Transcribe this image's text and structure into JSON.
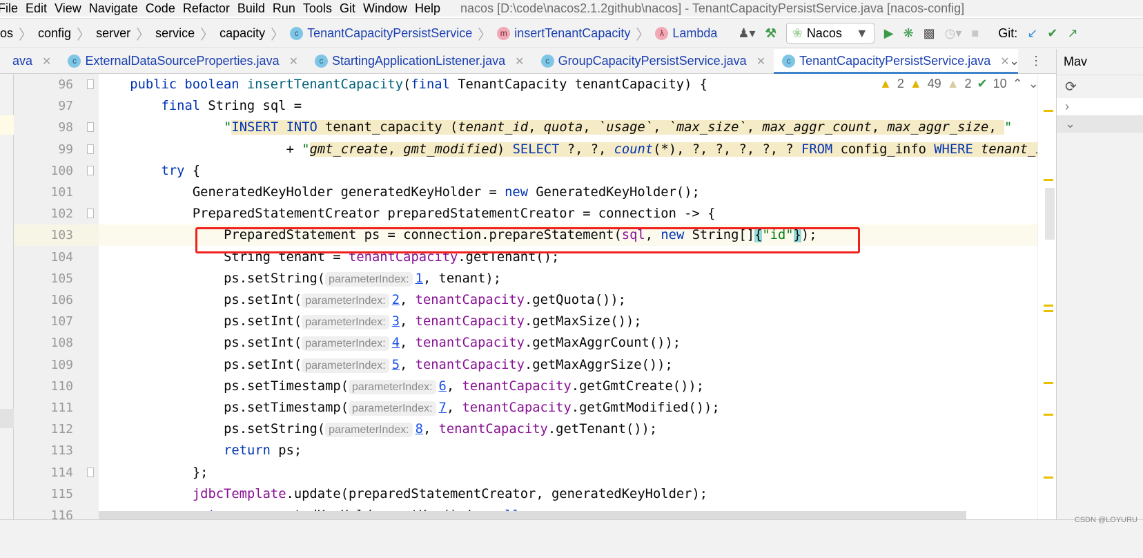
{
  "window_title": "nacos [D:\\code\\nacos2.1.2github\\nacos] - TenantCapacityPersistService.java [nacos-config]",
  "menu": [
    "File",
    "Edit",
    "View",
    "Navigate",
    "Code",
    "Refactor",
    "Build",
    "Run",
    "Tools",
    "Git",
    "Window",
    "Help"
  ],
  "breadcrumb": [
    "os",
    "config",
    "server",
    "service",
    "capacity",
    "TenantCapacityPersistService",
    "insertTenantCapacity",
    "Lambda"
  ],
  "toolbar": {
    "run_config": "Nacos",
    "git_label": "Git:"
  },
  "tabs": [
    {
      "label": "ava",
      "active": false
    },
    {
      "label": "ExternalDataSourceProperties.java",
      "active": false
    },
    {
      "label": "StartingApplicationListener.java",
      "active": false
    },
    {
      "label": "GroupCapacityPersistService.java",
      "active": false
    },
    {
      "label": "TenantCapacityPersistService.java",
      "active": true
    }
  ],
  "right_panel": {
    "label": "Mav"
  },
  "inspections": {
    "errors": "2",
    "warnings": "49",
    "weak_warnings": "2",
    "typos": "10"
  },
  "colors": {
    "keyword": "#0033b3",
    "string": "#067d17",
    "field": "#871094",
    "accent": "#4083c9",
    "annotation_box": "#f0201c"
  },
  "code": [
    {
      "n": "96",
      "indent": 4,
      "t": [
        [
          "kw",
          "public boolean "
        ],
        [
          "fn",
          "insertTenantCapacity"
        ],
        [
          "",
          "("
        ],
        [
          "kw",
          "final "
        ],
        [
          "",
          "TenantCapacity tenantCapacity) {"
        ]
      ]
    },
    {
      "n": "97",
      "indent": 8,
      "t": [
        [
          "kw",
          "final "
        ],
        [
          "",
          "String sql ="
        ]
      ]
    },
    {
      "n": "98",
      "indent": 16,
      "t": [
        [
          "str",
          "\""
        ],
        [
          "sql kw",
          "INSERT INTO "
        ],
        [
          "sql",
          "tenant_capacity ("
        ],
        [
          "sql it",
          "tenant_id"
        ],
        [
          "sql",
          ", "
        ],
        [
          "sql it",
          "quota"
        ],
        [
          "sql",
          ", "
        ],
        [
          "sql it",
          "`usage`"
        ],
        [
          "sql",
          ", "
        ],
        [
          "sql it",
          "`max_size`"
        ],
        [
          "sql",
          ", "
        ],
        [
          "sql it",
          "max_aggr_count"
        ],
        [
          "sql",
          ", "
        ],
        [
          "sql it",
          "max_aggr_size"
        ],
        [
          "sql",
          ", "
        ],
        [
          "str",
          "\""
        ]
      ]
    },
    {
      "n": "99",
      "indent": 24,
      "t": [
        [
          "",
          "+ "
        ],
        [
          "str",
          "\""
        ],
        [
          "sql it",
          "gmt_create"
        ],
        [
          "sql",
          ", "
        ],
        [
          "sql it",
          "gmt_modified"
        ],
        [
          "sql",
          ") "
        ],
        [
          "sql kw",
          "SELECT "
        ],
        [
          "sql",
          "?, ?, "
        ],
        [
          "sql kw it",
          "count"
        ],
        [
          "sql",
          "(*), ?, ?, ?, ?, ? "
        ],
        [
          "sql kw",
          "FROM "
        ],
        [
          "sql",
          "config_info "
        ],
        [
          "sql kw",
          "WHERE "
        ],
        [
          "sql it",
          "tenant_id = ?;                    "
        ]
      ]
    },
    {
      "n": "100",
      "indent": 8,
      "t": [
        [
          "kw",
          "try "
        ],
        [
          "",
          "{"
        ]
      ]
    },
    {
      "n": "101",
      "indent": 12,
      "t": [
        [
          "",
          "GeneratedKeyHolder generatedKeyHolder = "
        ],
        [
          "kw",
          "new "
        ],
        [
          "",
          "GeneratedKeyHolder();"
        ]
      ]
    },
    {
      "n": "102",
      "indent": 12,
      "t": [
        [
          "",
          "PreparedStatementCreator preparedStatementCreator = connection -> {"
        ]
      ]
    },
    {
      "n": "103",
      "indent": 16,
      "t": [
        [
          "",
          "PreparedStatement ps = connection.prepareStatement("
        ],
        [
          "fld",
          "sql"
        ],
        [
          "",
          ", "
        ],
        [
          "kw",
          "new "
        ],
        [
          "",
          "String[]"
        ],
        [
          "brace",
          "{"
        ],
        [
          "str",
          "\"id\""
        ],
        [
          "brace",
          "}"
        ],
        [
          "",
          ");"
        ]
      ]
    },
    {
      "n": "104",
      "indent": 16,
      "t": [
        [
          "",
          "String tenant = "
        ],
        [
          "fld",
          "tenantCapacity"
        ],
        [
          "",
          ".getTenant();"
        ]
      ]
    },
    {
      "n": "105",
      "indent": 16,
      "t": [
        [
          "",
          "ps.setString("
        ],
        [
          "hint",
          "parameterIndex:"
        ],
        [
          "num",
          "1"
        ],
        [
          "",
          ", tenant);"
        ]
      ]
    },
    {
      "n": "106",
      "indent": 16,
      "t": [
        [
          "",
          "ps.setInt("
        ],
        [
          "hint",
          "parameterIndex:"
        ],
        [
          "num",
          "2"
        ],
        [
          "",
          ", "
        ],
        [
          "fld",
          "tenantCapacity"
        ],
        [
          "",
          ".getQuota());"
        ]
      ]
    },
    {
      "n": "107",
      "indent": 16,
      "t": [
        [
          "",
          "ps.setInt("
        ],
        [
          "hint",
          "parameterIndex:"
        ],
        [
          "num",
          "3"
        ],
        [
          "",
          ", "
        ],
        [
          "fld",
          "tenantCapacity"
        ],
        [
          "",
          ".getMaxSize());"
        ]
      ]
    },
    {
      "n": "108",
      "indent": 16,
      "t": [
        [
          "",
          "ps.setInt("
        ],
        [
          "hint",
          "parameterIndex:"
        ],
        [
          "num",
          "4"
        ],
        [
          "",
          ", "
        ],
        [
          "fld",
          "tenantCapacity"
        ],
        [
          "",
          ".getMaxAggrCount());"
        ]
      ]
    },
    {
      "n": "109",
      "indent": 16,
      "t": [
        [
          "",
          "ps.setInt("
        ],
        [
          "hint",
          "parameterIndex:"
        ],
        [
          "num",
          "5"
        ],
        [
          "",
          ", "
        ],
        [
          "fld",
          "tenantCapacity"
        ],
        [
          "",
          ".getMaxAggrSize());"
        ]
      ]
    },
    {
      "n": "110",
      "indent": 16,
      "t": [
        [
          "",
          "ps.setTimestamp("
        ],
        [
          "hint",
          "parameterIndex:"
        ],
        [
          "num",
          "6"
        ],
        [
          "",
          ", "
        ],
        [
          "fld",
          "tenantCapacity"
        ],
        [
          "",
          ".getGmtCreate());"
        ]
      ]
    },
    {
      "n": "111",
      "indent": 16,
      "t": [
        [
          "",
          "ps.setTimestamp("
        ],
        [
          "hint",
          "parameterIndex:"
        ],
        [
          "num",
          "7"
        ],
        [
          "",
          ", "
        ],
        [
          "fld",
          "tenantCapacity"
        ],
        [
          "",
          ".getGmtModified());"
        ]
      ]
    },
    {
      "n": "112",
      "indent": 16,
      "t": [
        [
          "",
          "ps.setString("
        ],
        [
          "hint",
          "parameterIndex:"
        ],
        [
          "num",
          "8"
        ],
        [
          "",
          ", "
        ],
        [
          "fld",
          "tenantCapacity"
        ],
        [
          "",
          ".getTenant());"
        ]
      ]
    },
    {
      "n": "113",
      "indent": 16,
      "t": [
        [
          "kw",
          "return "
        ],
        [
          "",
          "ps;"
        ]
      ]
    },
    {
      "n": "114",
      "indent": 12,
      "t": [
        [
          "",
          "};"
        ]
      ]
    },
    {
      "n": "115",
      "indent": 12,
      "t": [
        [
          "fld",
          "jdbcTemplate"
        ],
        [
          "",
          ".update(preparedStatementCreator, generatedKeyHolder);"
        ]
      ]
    },
    {
      "n": "116",
      "indent": 12,
      "t": [
        [
          "kw",
          "return "
        ],
        [
          "",
          "generatedKeyHolder.getKey() != "
        ],
        [
          "kw",
          "null"
        ],
        [
          "",
          ";"
        ]
      ]
    }
  ],
  "watermark": "CSDN @LOYURU"
}
